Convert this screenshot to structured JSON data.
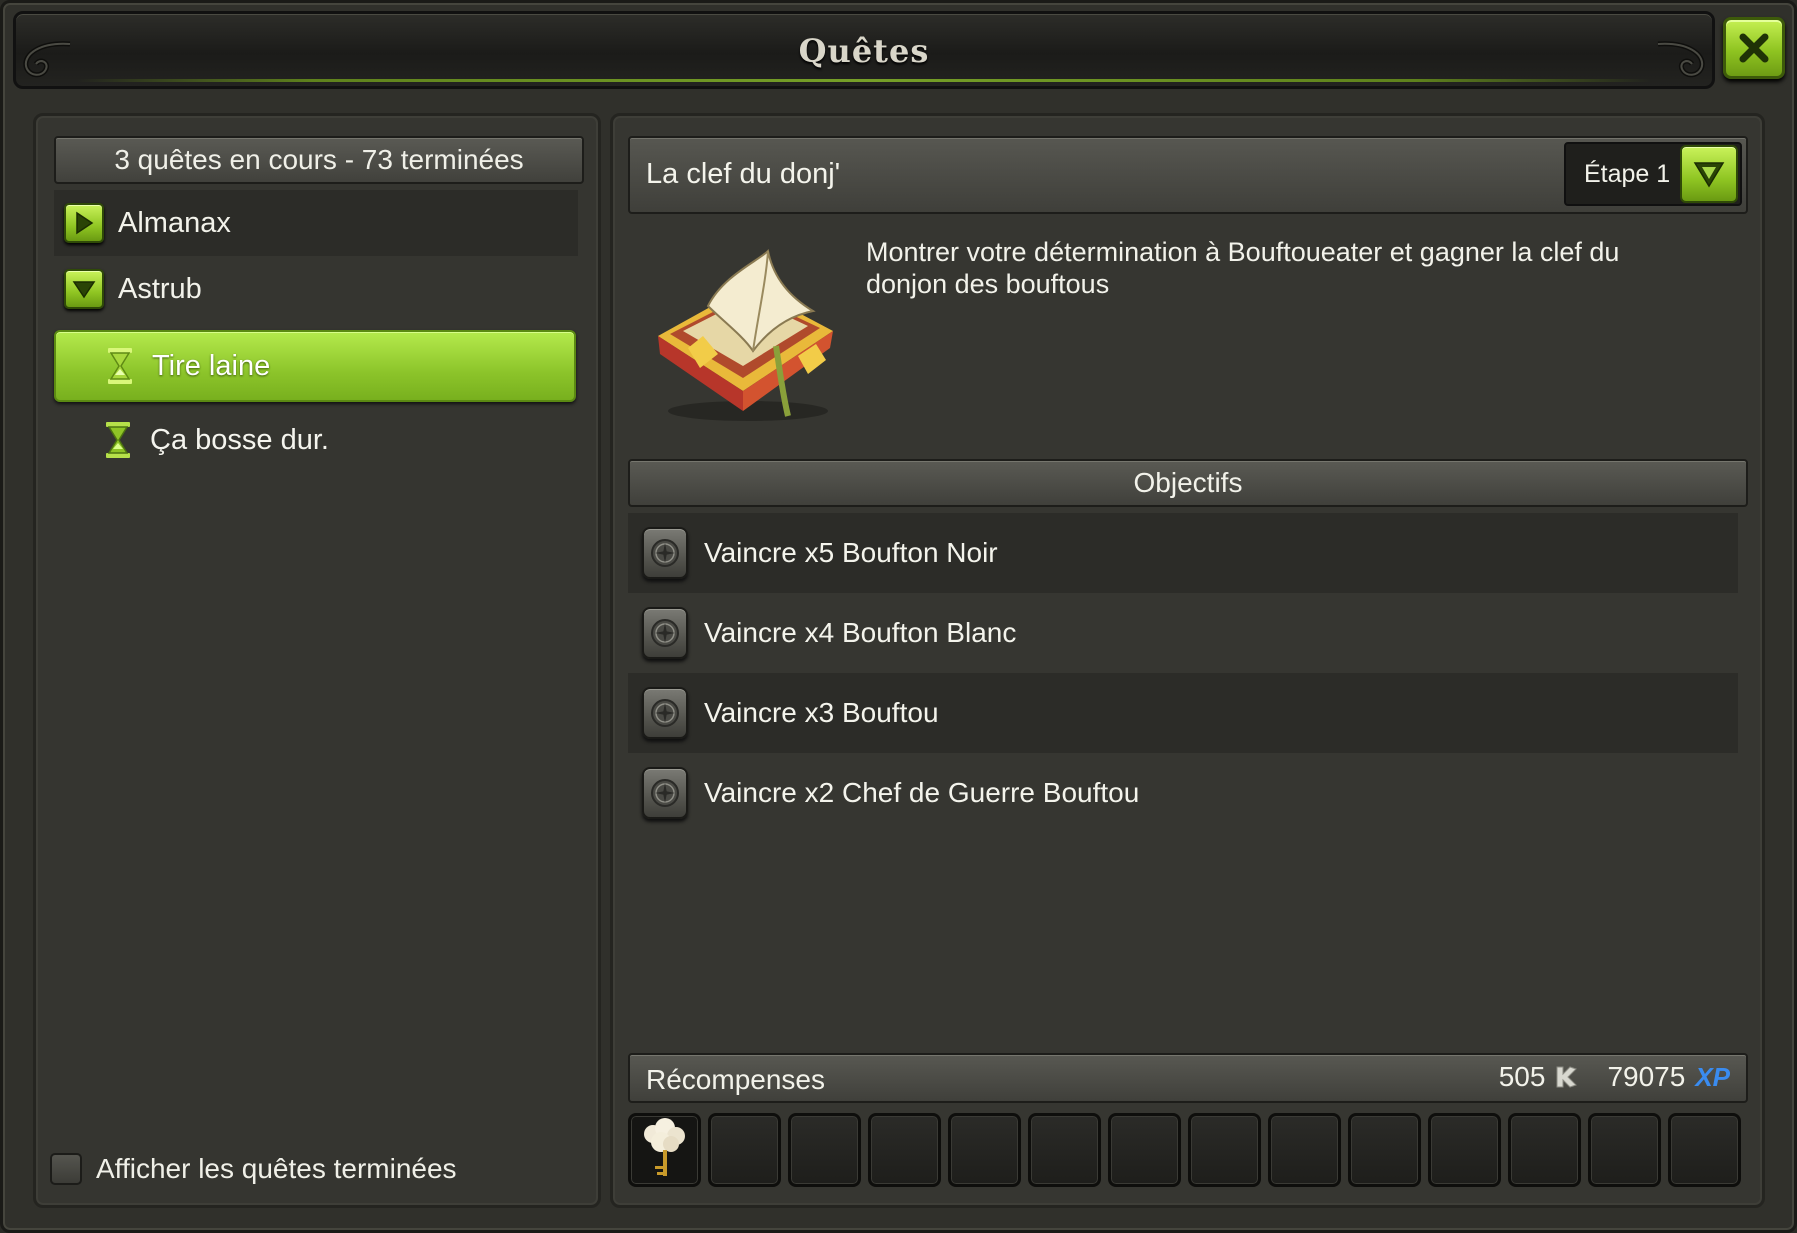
{
  "window": {
    "title": "Quêtes",
    "close_icon": "close-x-icon"
  },
  "colors": {
    "accent_green": "#8cc42a",
    "panel_dark": "#30302b",
    "xp_blue": "#3a8cf0"
  },
  "sidebar": {
    "summary": "3 quêtes en cours - 73 terminées",
    "categories": [
      {
        "label": "Almanax",
        "icon": "expand-right-arrow-icon",
        "expanded": false
      },
      {
        "label": "Astrub",
        "icon": "collapse-down-arrow-icon",
        "expanded": true
      }
    ],
    "quests": [
      {
        "label": "Tire laine",
        "icon": "hourglass-icon",
        "selected": true
      },
      {
        "label": "Ça bosse dur.",
        "icon": "hourglass-icon",
        "selected": false
      }
    ],
    "show_completed_label": "Afficher les quêtes terminées",
    "show_completed_checked": false
  },
  "quest": {
    "name": "La clef du donj'",
    "step_label": "Étape 1",
    "step_icon": "dropdown-arrow-icon",
    "image_icon": "quest-book-icon",
    "description": "Montrer votre détermination à Bouftoueater et gagner la clef du donjon des bouftous"
  },
  "objectives": {
    "header": "Objectifs",
    "items": [
      {
        "label": "Vaincre x5 Boufton Noir",
        "icon": "compass-objective-icon"
      },
      {
        "label": "Vaincre x4 Boufton Blanc",
        "icon": "compass-objective-icon"
      },
      {
        "label": "Vaincre x3 Bouftou",
        "icon": "compass-objective-icon"
      },
      {
        "label": "Vaincre x2 Chef de Guerre Bouftou",
        "icon": "compass-objective-icon"
      }
    ]
  },
  "rewards": {
    "label": "Récompenses",
    "kamas": "505",
    "kamas_icon": "kamas-icon",
    "xp": "79075",
    "xp_label": "XP",
    "items": [
      {
        "icon": "wool-key-icon"
      }
    ],
    "empty_slots": 13
  }
}
